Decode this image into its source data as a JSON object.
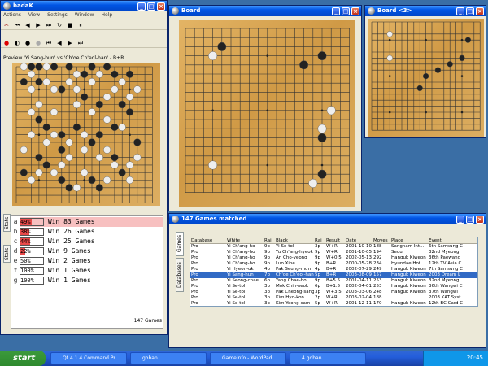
{
  "badak": {
    "title": "badaK",
    "menu": [
      "Actions",
      "View",
      "Settings",
      "Window",
      "Help"
    ],
    "preview_title": "Preview 'Yi Sang-hun' vs 'Ch'oe Ch'eol-han' - B+R",
    "tabs": [
      "Stats",
      "Stats"
    ],
    "stats": [
      {
        "key": "a",
        "pct": "49%",
        "rest": "Win 83 Games",
        "fill": 0.49,
        "highlight": true
      },
      {
        "key": "b",
        "pct": "38%",
        "rest": "Win 26 Games",
        "fill": 0.38,
        "highlight": false
      },
      {
        "key": "c",
        "pct": "44%",
        "rest": "Win 25 Games",
        "fill": 0.44,
        "highlight": false
      },
      {
        "key": "d",
        "pct": "22%",
        "rest": "Win 9 Games",
        "fill": 0.22,
        "highlight": false
      },
      {
        "key": "e",
        "pct": "50%",
        "rest": "Win 2 Games",
        "fill": 0.0,
        "highlight": false
      },
      {
        "key": "f",
        "pct": "100%",
        "rest": "Win 1 Games",
        "fill": 0.0,
        "highlight": false
      },
      {
        "key": "g",
        "pct": "100%",
        "rest": "Win 1 Games",
        "fill": 0.0,
        "highlight": false
      }
    ],
    "footer": "147 Games"
  },
  "board": {
    "title": "Board"
  },
  "board3": {
    "title": "Board <3>"
  },
  "games": {
    "title": "147 Games matched",
    "side_tabs": [
      "Games",
      "Databases"
    ],
    "columns": [
      "Database",
      "White",
      "Rai",
      "Black",
      "Rai",
      "Result",
      "Date",
      "Moves",
      "Place",
      "Event"
    ],
    "rows": [
      [
        "Pro",
        "Yi Ch'ang-ho",
        "9p",
        "Yi Se-tol",
        "3p",
        "W+R",
        "2001-10-10",
        "188",
        "Sangnam Int...",
        "6th Samsung C"
      ],
      [
        "Pro",
        "Yi Ch'ang-ho",
        "9p",
        "Yu Ch'ang-hyeok",
        "9p",
        "W+R",
        "2001-10-05",
        "194",
        "Seoul",
        "32nd Myeongi"
      ],
      [
        "Pro",
        "Yi Ch'ang-ho",
        "9p",
        "An Cho-yeong",
        "9p",
        "W+0.5",
        "2002-05-13",
        "292",
        "Hanguk Kiweon",
        "36th Paewang"
      ],
      [
        "Pro",
        "Yi Ch'ang-ho",
        "9p",
        "Luo Xihe",
        "9p",
        "B+R",
        "2000-05-28",
        "234",
        "Hyundae Hot...",
        "12th TV Asia C"
      ],
      [
        "Pro",
        "Yi Hyeon-uk",
        "4p",
        "Pak Seung-mun",
        "4p",
        "B+R",
        "2002-07-29",
        "249",
        "Hanguk Kiweon",
        "7th Samsung C"
      ],
      [
        "Pro",
        "Yi Sang-hun",
        "7p",
        "Ch'oe Ch'eol-han",
        "5p",
        "B+R",
        "2003-08-09",
        "157",
        "Hanguk Kiweon",
        "2003 Dream L"
      ],
      [
        "Pro",
        "Yi Seong-chae",
        "6p",
        "Yang Chae-ho",
        "9p",
        "B+5.5",
        "2001-04-11",
        "253",
        "Hanguk Kiweon",
        "32nd Myeongi"
      ],
      [
        "Pro",
        "Yi Se-tol",
        "3p",
        "Mok Chin-seok",
        "6p",
        "B+1.5",
        "2002-04-01",
        "253",
        "Hanguk Kiweon",
        "36th Wangwi C"
      ],
      [
        "Pro",
        "Yi Se-tol",
        "3p",
        "Pak Cheong-sang",
        "3p",
        "W+3.5",
        "2003-03-06",
        "248",
        "Hanguk Kiweon",
        "37th Wangwi"
      ],
      [
        "Pro",
        "Yi Se-tol",
        "3p",
        "Kim Hyo-kon",
        "2p",
        "W+R",
        "2003-02-04",
        "188",
        "",
        "2003 KAT Syst"
      ],
      [
        "Pro",
        "Yi Se-tol",
        "3p",
        "Kim Yeong-sam",
        "5p",
        "W+R",
        "2001-12-11",
        "170",
        "Hanguk Kiweon",
        "12th BC Card C"
      ],
      [
        "Pro",
        "Yi Yong-ch'an",
        "4p",
        "Pak Seung-ch'eol",
        "3p",
        "B+R",
        "2003-07-28",
        "280",
        "Hanguk Kiweon",
        "7th SK New St"
      ],
      [
        "Pro",
        "Yoda Norimoto",
        "9p",
        "Cho Chikun",
        "9p",
        "B+10.5",
        "2001-02-24",
        "228",
        "Osaka",
        "20th NEC Cup"
      ]
    ],
    "selected": 5
  },
  "taskbar": {
    "start": "start",
    "buttons": [
      "Qt 4.1.4 Command Pr...",
      "goban",
      "GameInfo - WordPad",
      "4 goban"
    ],
    "clock": "20:45"
  }
}
